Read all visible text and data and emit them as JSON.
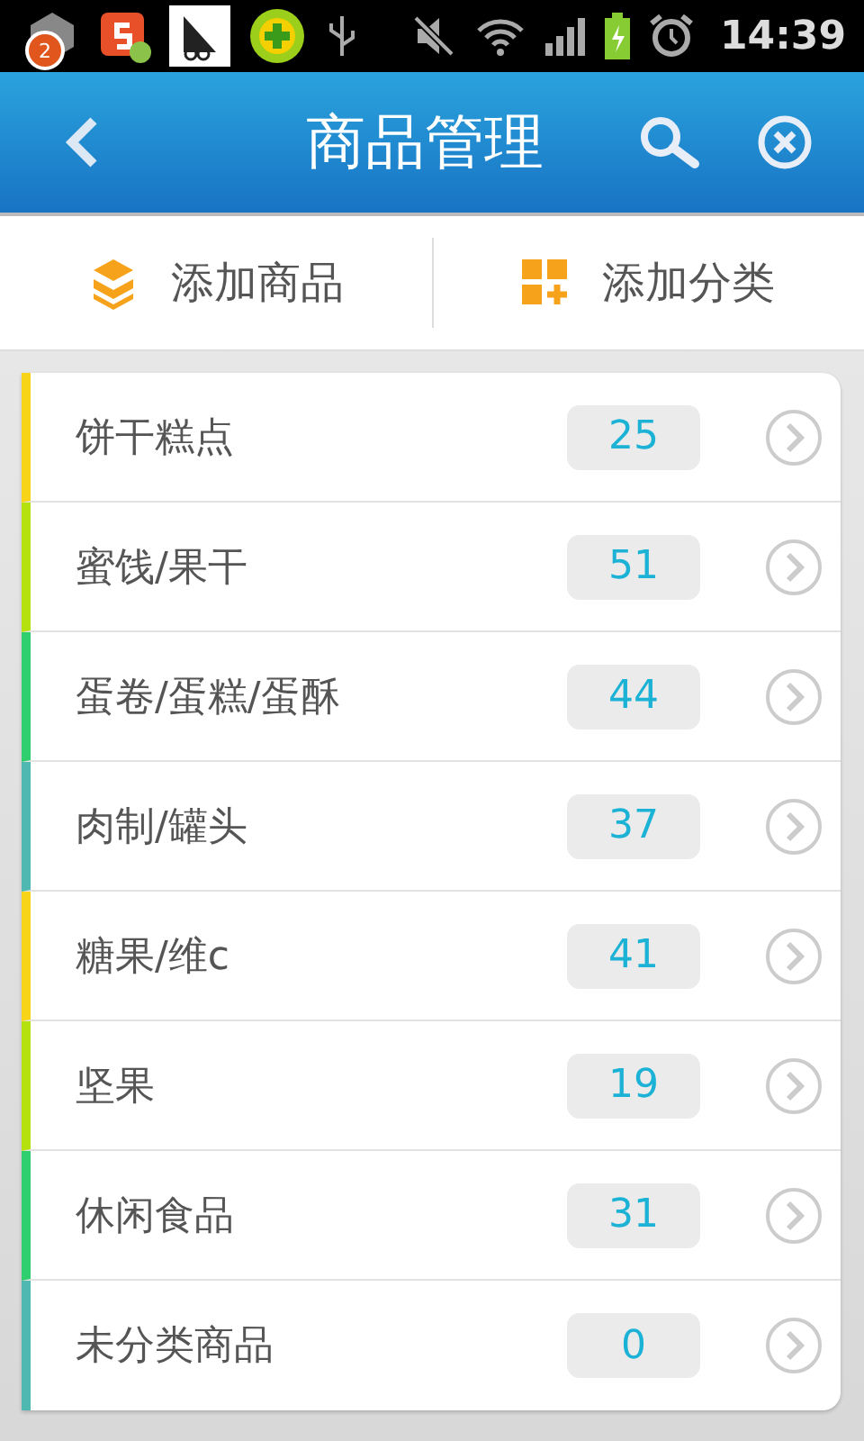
{
  "status_bar": {
    "notification_count": "2",
    "time": "14:39"
  },
  "header": {
    "title": "商品管理"
  },
  "actions": [
    {
      "kind": "box",
      "label": "添加商品"
    },
    {
      "kind": "grid",
      "label": "添加分类"
    }
  ],
  "categories": [
    {
      "name": "饼干糕点",
      "count": "25",
      "color": "#f7d417"
    },
    {
      "name": "蜜饯/果干",
      "count": "51",
      "color": "#b5e10f"
    },
    {
      "name": "蛋卷/蛋糕/蛋酥",
      "count": "44",
      "color": "#2fcf6f"
    },
    {
      "name": "肉制/罐头",
      "count": "37",
      "color": "#4fb8b0"
    },
    {
      "name": "糖果/维c",
      "count": "41",
      "color": "#f7d417"
    },
    {
      "name": "坚果",
      "count": "19",
      "color": "#b5e10f"
    },
    {
      "name": "休闲食品",
      "count": "31",
      "color": "#2fcf6f"
    },
    {
      "name": "未分类商品",
      "count": "0",
      "color": "#4fb8b0"
    }
  ]
}
